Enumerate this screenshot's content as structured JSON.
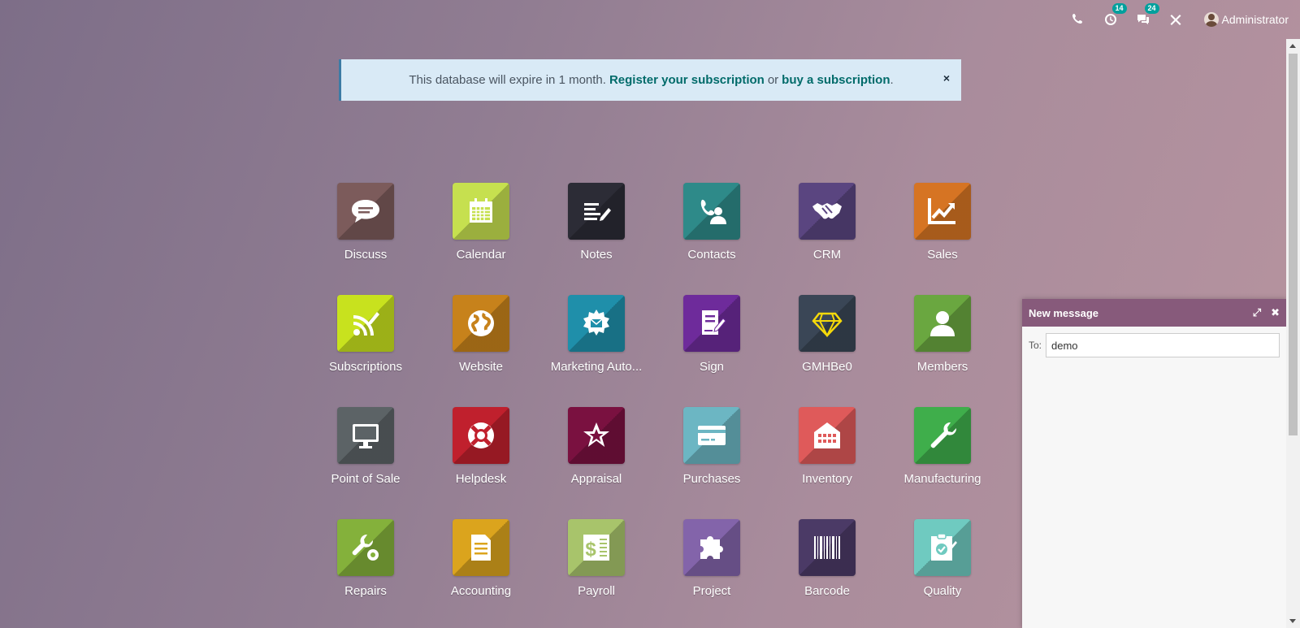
{
  "systray": {
    "activity_badge": "14",
    "messages_badge": "24",
    "user_name": "Administrator"
  },
  "banner": {
    "text": "This database will expire in 1 month.",
    "register_link": "Register your subscription",
    "or_text": "or",
    "buy_link": "buy a subscription",
    "period": ".",
    "close": "×"
  },
  "apps": [
    {
      "label": "Discuss",
      "color": "#7c5b5b",
      "icon": "chat-bubble-icon"
    },
    {
      "label": "Calendar",
      "color": "#c6e04f",
      "icon": "calendar-icon"
    },
    {
      "label": "Notes",
      "color": "#2c2c36",
      "icon": "notes-icon"
    },
    {
      "label": "Contacts",
      "color": "#2e8a89",
      "icon": "contacts-icon"
    },
    {
      "label": "CRM",
      "color": "#5a4580",
      "icon": "handshake-icon"
    },
    {
      "label": "Sales",
      "color": "#d67423",
      "icon": "trending-up-icon"
    },
    {
      "label": "Subscriptions",
      "color": "#c8e21e",
      "icon": "rss-pencil-icon"
    },
    {
      "label": "Website",
      "color": "#c7821b",
      "icon": "globe-icon"
    },
    {
      "label": "Marketing Auto...",
      "color": "#1f8faa",
      "icon": "gear-envelope-icon"
    },
    {
      "label": "Sign",
      "color": "#6e2b9b",
      "icon": "sign-document-icon"
    },
    {
      "label": "GMHBe0",
      "color": "#3a4656",
      "icon": "diamond-icon"
    },
    {
      "label": "Members",
      "color": "#6aa740",
      "icon": "member-icon"
    },
    {
      "label": "Point of Sale",
      "color": "#5c6366",
      "icon": "monitor-icon"
    },
    {
      "label": "Helpdesk",
      "color": "#c0202d",
      "icon": "lifebuoy-icon"
    },
    {
      "label": "Appraisal",
      "color": "#7a1140",
      "icon": "star-icon"
    },
    {
      "label": "Purchases",
      "color": "#6cb6c3",
      "icon": "credit-card-icon"
    },
    {
      "label": "Inventory",
      "color": "#df5a5a",
      "icon": "warehouse-icon"
    },
    {
      "label": "Manufacturing",
      "color": "#3fae4b",
      "icon": "wrench-icon"
    },
    {
      "label": "Repairs",
      "color": "#84b13b",
      "icon": "wrench-gear-icon"
    },
    {
      "label": "Accounting",
      "color": "#dba41d",
      "icon": "document-icon"
    },
    {
      "label": "Payroll",
      "color": "#a8c46b",
      "icon": "payroll-icon"
    },
    {
      "label": "Project",
      "color": "#8364aa",
      "icon": "puzzle-icon"
    },
    {
      "label": "Barcode",
      "color": "#4b3a66",
      "icon": "barcode-icon"
    },
    {
      "label": "Quality",
      "color": "#6fcac0",
      "icon": "quality-check-icon"
    }
  ],
  "chat": {
    "title": "New message",
    "to_label": "To:",
    "to_value": "demo"
  }
}
